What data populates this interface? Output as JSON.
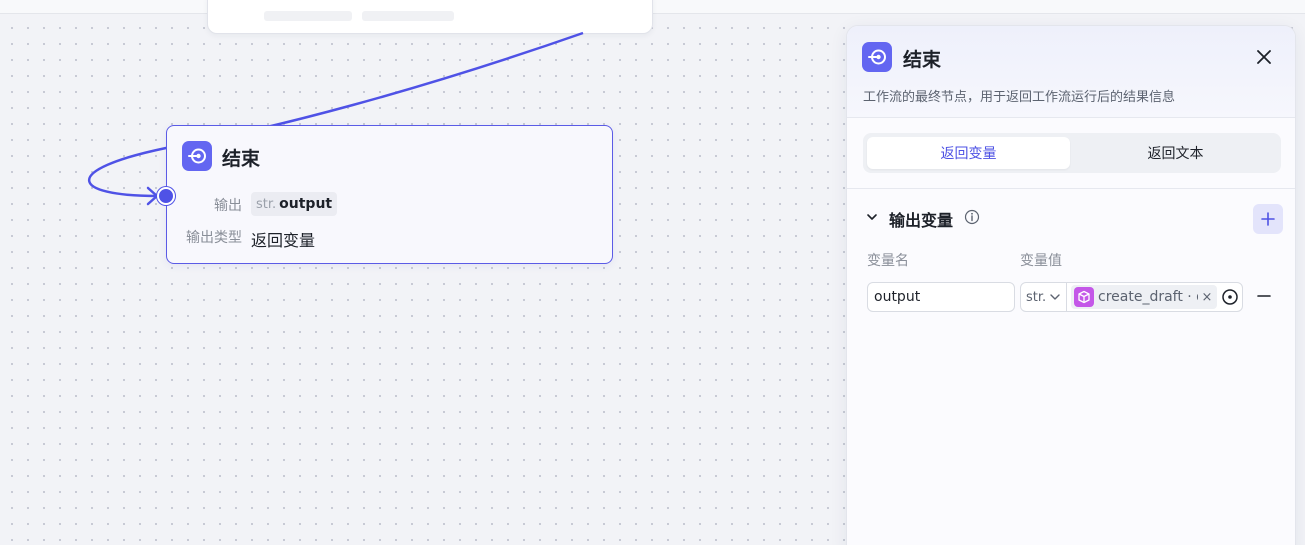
{
  "canvas": {
    "edge_color": "#4f52e6"
  },
  "end_node": {
    "icon": "end-node-icon",
    "title": "结束",
    "output_label": "输出",
    "output_type": "str.",
    "output_name": "output",
    "output_type_label": "输出类型",
    "output_type_value": "返回变量",
    "accent": "#6366f1"
  },
  "panel": {
    "icon": "end-node-icon",
    "title": "结束",
    "close_icon": "close-icon",
    "description": "工作流的最终节点，用于返回工作流运行后的结果信息",
    "tabs": [
      {
        "label": "返回变量",
        "active": true
      },
      {
        "label": "返回文本",
        "active": false
      }
    ],
    "section": {
      "title": "输出变量",
      "collapse_icon": "chevron-down-icon",
      "info_icon": "info-icon",
      "add_icon": "plus-icon"
    },
    "columns": {
      "name": "变量名",
      "value": "变量值"
    },
    "row": {
      "name_value": "output",
      "type": "str.",
      "type_icon": "chevron-down-icon",
      "reference_icon": "cube-icon",
      "reference_text": "create_draft · draft_url",
      "clear_label": "×",
      "picker_icon": "target-icon",
      "remove_icon": "minus-icon"
    }
  }
}
